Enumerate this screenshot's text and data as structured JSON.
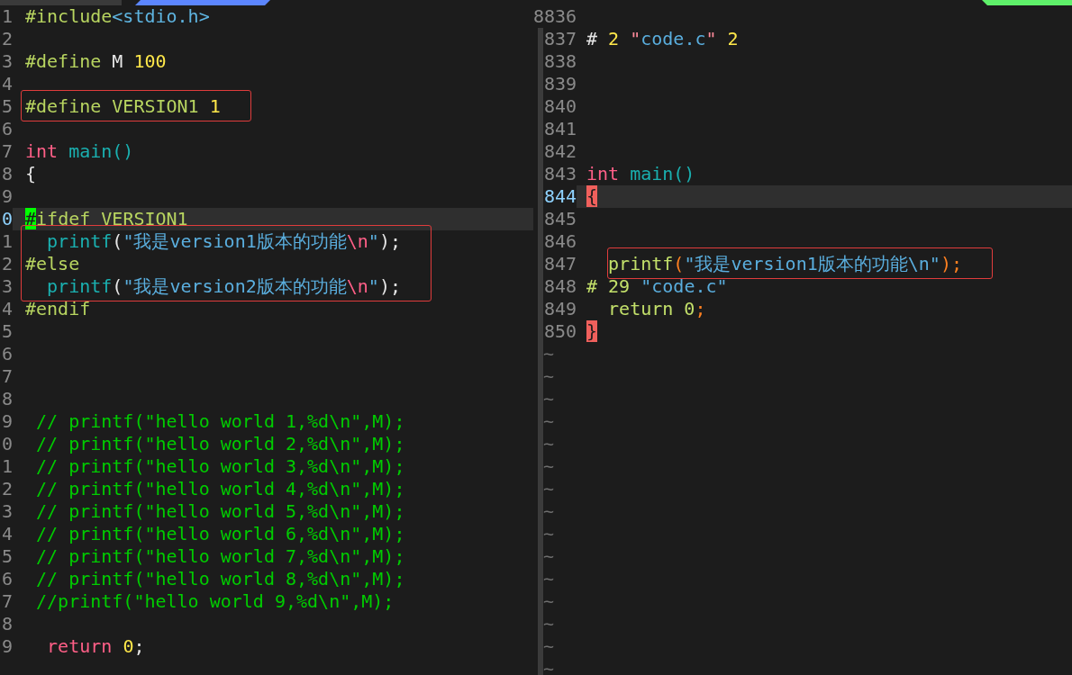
{
  "tabline": {
    "tabs": [
      {
        "selected": false
      },
      {
        "selected": true
      }
    ],
    "buffers_marker": true
  },
  "panes": [
    {
      "lines": [
        {
          "number": "1",
          "current": false,
          "boxed": false,
          "tokens": [
            {
              "kind": "pre",
              "text": "#include"
            },
            {
              "kind": "inc",
              "text": "<stdio.h>"
            }
          ]
        },
        {
          "number": "2",
          "current": false,
          "boxed": false
        },
        {
          "number": "3",
          "current": false,
          "boxed": false,
          "tokens": [
            {
              "kind": "pre",
              "text": "#define"
            },
            {
              "kind": "plain",
              "text": " M "
            },
            {
              "kind": "num",
              "text": "100"
            }
          ]
        },
        {
          "number": "4",
          "current": false,
          "boxed": false
        },
        {
          "number": "5",
          "current": false,
          "boxed": true,
          "tokens": [
            {
              "kind": "pre",
              "text": "#define VERSION1 "
            },
            {
              "kind": "num",
              "text": "1"
            }
          ]
        },
        {
          "number": "6",
          "current": false,
          "boxed": false
        },
        {
          "number": "7",
          "current": false,
          "boxed": false,
          "tokens": [
            {
              "kind": "type",
              "text": "int"
            },
            {
              "kind": "fn",
              "text": " main()"
            }
          ]
        },
        {
          "number": "8",
          "current": false,
          "boxed": false,
          "tokens": [
            {
              "kind": "plain",
              "text": "{"
            }
          ]
        },
        {
          "number": "9",
          "current": false,
          "boxed": false
        },
        {
          "number": "0",
          "current": true,
          "boxed": false,
          "tokens": [
            {
              "kind": "cursor",
              "text": "#"
            },
            {
              "kind": "pre",
              "text": "ifdef VERSION1"
            }
          ]
        },
        {
          "number": "1",
          "current": false,
          "boxed": true,
          "tokens": [
            {
              "kind": "fn",
              "text": "  printf"
            },
            {
              "kind": "plain",
              "text": "("
            },
            {
              "kind": "str",
              "text": "\"我是version1版本的功能"
            },
            {
              "kind": "esc",
              "text": "\\n"
            },
            {
              "kind": "str",
              "text": "\""
            },
            {
              "kind": "plain",
              "text": ");"
            }
          ]
        },
        {
          "number": "2",
          "current": false,
          "boxed": true,
          "tokens": [
            {
              "kind": "pre",
              "text": "#else"
            }
          ]
        },
        {
          "number": "3",
          "current": false,
          "boxed": true,
          "tokens": [
            {
              "kind": "fn",
              "text": "  printf"
            },
            {
              "kind": "plain",
              "text": "("
            },
            {
              "kind": "str",
              "text": "\"我是version2版本的功能"
            },
            {
              "kind": "esc",
              "text": "\\n"
            },
            {
              "kind": "str",
              "text": "\""
            },
            {
              "kind": "plain",
              "text": ");"
            }
          ]
        },
        {
          "number": "4",
          "current": false,
          "boxed": false,
          "tokens": [
            {
              "kind": "pre",
              "text": "#endif"
            }
          ]
        },
        {
          "number": "5",
          "current": false,
          "boxed": false
        },
        {
          "number": "6",
          "current": false,
          "boxed": false
        },
        {
          "number": "7",
          "current": false,
          "boxed": false
        },
        {
          "number": "8",
          "current": false,
          "boxed": false
        },
        {
          "number": "9",
          "current": false,
          "boxed": false,
          "tokens": [
            {
              "kind": "cmt",
              "text": " // printf(\"hello world 1,%d\\n\",M);"
            }
          ]
        },
        {
          "number": "0",
          "current": false,
          "boxed": false,
          "tokens": [
            {
              "kind": "cmt",
              "text": " // printf(\"hello world 2,%d\\n\",M);"
            }
          ]
        },
        {
          "number": "1",
          "current": false,
          "boxed": false,
          "tokens": [
            {
              "kind": "cmt",
              "text": " // printf(\"hello world 3,%d\\n\",M);"
            }
          ]
        },
        {
          "number": "2",
          "current": false,
          "boxed": false,
          "tokens": [
            {
              "kind": "cmt",
              "text": " // printf(\"hello world 4,%d\\n\",M);"
            }
          ]
        },
        {
          "number": "3",
          "current": false,
          "boxed": false,
          "tokens": [
            {
              "kind": "cmt",
              "text": " // printf(\"hello world 5,%d\\n\",M);"
            }
          ]
        },
        {
          "number": "4",
          "current": false,
          "boxed": false,
          "tokens": [
            {
              "kind": "cmt",
              "text": " // printf(\"hello world 6,%d\\n\",M);"
            }
          ]
        },
        {
          "number": "5",
          "current": false,
          "boxed": false,
          "tokens": [
            {
              "kind": "cmt",
              "text": " // printf(\"hello world 7,%d\\n\",M);"
            }
          ]
        },
        {
          "number": "6",
          "current": false,
          "boxed": false,
          "tokens": [
            {
              "kind": "cmt",
              "text": " // printf(\"hello world 8,%d\\n\",M);"
            }
          ]
        },
        {
          "number": "7",
          "current": false,
          "boxed": false,
          "tokens": [
            {
              "kind": "cmt",
              "text": " //printf(\"hello world 9,%d\\n\",M);"
            }
          ]
        },
        {
          "number": "8",
          "current": false,
          "boxed": false
        },
        {
          "number": "9",
          "current": false,
          "boxed": false,
          "tokens": [
            {
              "kind": "kw",
              "text": "  return "
            },
            {
              "kind": "num",
              "text": "0"
            },
            {
              "kind": "plain",
              "text": ";"
            }
          ]
        }
      ]
    },
    {
      "lines": [
        {
          "number": "8836",
          "current": false,
          "boxed": false
        },
        {
          "number": "837",
          "current": false,
          "boxed": false,
          "tokens": [
            {
              "kind": "plain",
              "text": "# "
            },
            {
              "kind": "num",
              "text": "2"
            },
            {
              "kind": "quote",
              "text": " \""
            },
            {
              "kind": "str",
              "text": "code.c"
            },
            {
              "kind": "quote",
              "text": "\" "
            },
            {
              "kind": "num",
              "text": "2"
            }
          ]
        },
        {
          "number": "838",
          "current": false,
          "boxed": false
        },
        {
          "number": "839",
          "current": false,
          "boxed": false
        },
        {
          "number": "840",
          "current": false,
          "boxed": false
        },
        {
          "number": "841",
          "current": false,
          "boxed": false
        },
        {
          "number": "842",
          "current": false,
          "boxed": false
        },
        {
          "number": "843",
          "current": false,
          "boxed": false,
          "tokens": [
            {
              "kind": "type",
              "text": "int"
            },
            {
              "kind": "fn",
              "text": " main()"
            }
          ]
        },
        {
          "number": "844",
          "current": true,
          "boxed": false,
          "tokens": [
            {
              "kind": "match",
              "text": "{"
            }
          ]
        },
        {
          "number": "845",
          "current": false,
          "boxed": false
        },
        {
          "number": "846",
          "current": false,
          "boxed": false
        },
        {
          "number": "847",
          "current": false,
          "boxed": true,
          "tokens": [
            {
              "kind": "lime",
              "text": "  printf"
            },
            {
              "kind": "orange",
              "text": "("
            },
            {
              "kind": "str",
              "text": "\"我是version1版本的功能\\n\""
            },
            {
              "kind": "orange",
              "text": ");"
            }
          ]
        },
        {
          "number": "848",
          "current": false,
          "boxed": false,
          "tokens": [
            {
              "kind": "lime",
              "text": "# 29 "
            },
            {
              "kind": "str",
              "text": "\"code.c\""
            }
          ]
        },
        {
          "number": "849",
          "current": false,
          "boxed": false,
          "tokens": [
            {
              "kind": "lime",
              "text": "  return 0"
            },
            {
              "kind": "orange",
              "text": ";"
            }
          ]
        },
        {
          "number": "850",
          "current": false,
          "boxed": false,
          "tokens": [
            {
              "kind": "match",
              "text": "}"
            }
          ]
        }
      ],
      "filler": [
        "~",
        "~",
        "~",
        "~",
        "~",
        "~",
        "~",
        "~",
        "~",
        "~",
        "~",
        "~",
        "~",
        "~",
        "~"
      ]
    }
  ]
}
